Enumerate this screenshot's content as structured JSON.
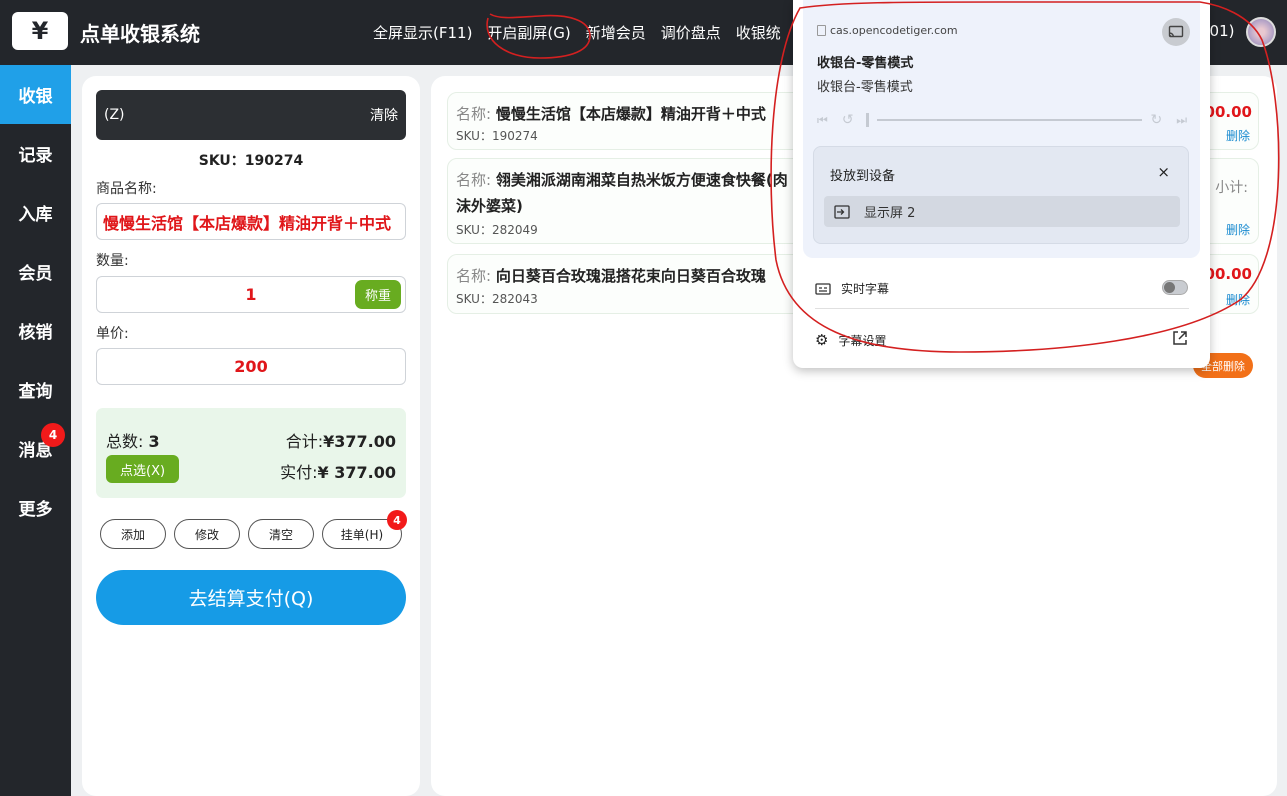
{
  "app": {
    "logo": "¥",
    "title": "点单收银系统",
    "user_id_fragment": "001)"
  },
  "topnav": [
    "全屏显示(F11)",
    "开启副屏(G)",
    "新增会员",
    "调价盘点",
    "收银统"
  ],
  "sidebar": [
    {
      "label": "收银",
      "active": true
    },
    {
      "label": "记录"
    },
    {
      "label": "入库"
    },
    {
      "label": "会员"
    },
    {
      "label": "核销"
    },
    {
      "label": "查询"
    },
    {
      "label": "消息",
      "badge": "4"
    },
    {
      "label": "更多"
    }
  ],
  "scan": {
    "shortcut": "(Z)",
    "clear": "清除"
  },
  "current": {
    "sku_line": "SKU：190274",
    "name_label": "商品名称:",
    "name_value": "慢慢生活馆【本店爆款】精油开背＋中式",
    "qty_label": "数量:",
    "qty_value": "1",
    "weigh_btn": "称重",
    "price_label": "单价:",
    "price_value": "200"
  },
  "summary": {
    "count_label": "总数:",
    "count_value": "3",
    "total_label": "合计:",
    "total_value": "¥377.00",
    "paid_label": "实付:",
    "paid_value": "¥ 377.00",
    "pick_btn": "点选(X)"
  },
  "actions": [
    {
      "label": "添加"
    },
    {
      "label": "修改"
    },
    {
      "label": "清空"
    },
    {
      "label": "挂单(H)",
      "badge": "4"
    }
  ],
  "pay_btn": "去结算支付(Q)",
  "cart": {
    "name_label": "名称:",
    "subtotal_label": "小计:",
    "delete_label": "删除",
    "clear_all": "全部删除",
    "items": [
      {
        "name": "慢慢生活馆【本店爆款】精油开背＋中式",
        "sku": "SKU：190274",
        "price": "00.00"
      },
      {
        "name": "翎美湘派湖南湘菜自热米饭方便速食快餐(肉沫外婆菜)",
        "sku": "SKU：282049",
        "price": ""
      },
      {
        "name": "向日葵百合玫瑰混搭花束向日葵百合玫瑰",
        "sku": "SKU：282043",
        "price": "00.00"
      }
    ]
  },
  "cast_popup": {
    "site": "cas.opencodetiger.com",
    "title": "收银台-零售模式",
    "subtitle": "收银台-零售模式",
    "cast_to_label": "投放到设备",
    "close": "×",
    "device": "显示屏 2",
    "captions_label": "实时字幕",
    "captions_enabled": false,
    "caption_settings_label": "字幕设置"
  },
  "colors": {
    "topbar": "#23262b",
    "accent_blue": "#169be6",
    "green": "#68ac20",
    "red": "#e0161a",
    "orange": "#f27018",
    "annotation_red": "#d42020"
  }
}
